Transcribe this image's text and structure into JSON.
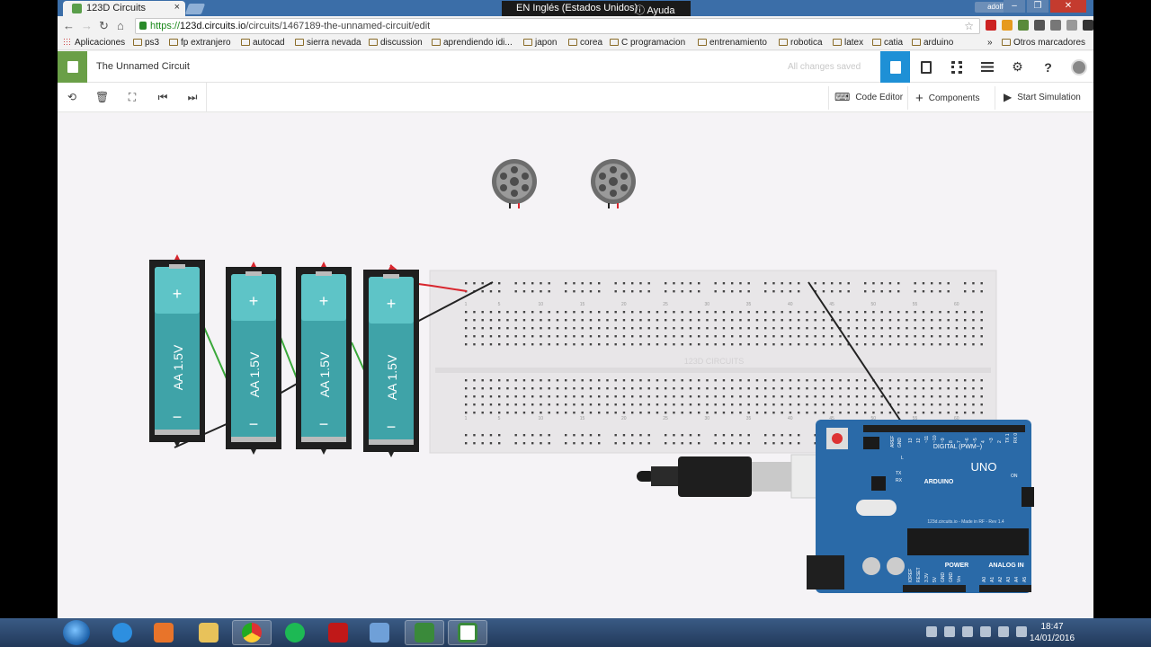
{
  "browser": {
    "tab_title": "123D Circuits",
    "tab_close": "×",
    "language_bar": "EN Inglés (Estados Unidos)",
    "help_label": "Ayuda",
    "user_badge": "adolfo",
    "url_scheme": "https://",
    "url_host": "123d.circuits.io",
    "url_path": "/circuits/1467189-the-unnamed-circuit/edit",
    "bookmarks": [
      "Aplicaciones",
      "ps3",
      "fp extranjero",
      "autocad",
      "sierra nevada",
      "discussion",
      "aprendiendo idi...",
      "japon",
      "corea",
      "C programacion",
      "entrenamiento",
      "robotica",
      "latex",
      "catia",
      "arduino"
    ],
    "bookmarks_overflow": "»",
    "other_bookmarks": "Otros marcadores"
  },
  "app": {
    "circuit_name": "The Unnamed Circuit",
    "save_status": "All changes saved",
    "header_icons": [
      "breadboard-view-icon",
      "schematic-view-icon",
      "pcb-view-icon",
      "component-list-icon",
      "settings-icon",
      "help-icon",
      "user-avatar-icon"
    ],
    "help_glyph": "?",
    "toolbar": {
      "code_editor": "Code Editor",
      "components": "Components",
      "start_simulation": "Start Simulation"
    }
  },
  "canvas": {
    "battery_label": "AA 1.5V",
    "battery_plus": "+",
    "battery_minus": "−",
    "breadboard_watermark": "123D CIRCUITS",
    "breadboard_columns": [
      "1",
      "5",
      "10",
      "15",
      "20",
      "25",
      "30",
      "35",
      "40",
      "45",
      "50",
      "55",
      "60"
    ],
    "breadboard_rows_top": [
      "J",
      "I",
      "H",
      "G",
      "F"
    ],
    "breadboard_rows_bottom": [
      "E",
      "D",
      "C",
      "B",
      "A"
    ],
    "arduino": {
      "brand": "ARDUINO",
      "model": "UNO",
      "digital_label": "DIGITAL (PWM~)",
      "power_label": "POWER",
      "analog_label": "ANALOG IN",
      "footer_text": "123d.circuits.io - Made in RF - Rev 1.4",
      "leds": [
        "L",
        "TX",
        "RX"
      ],
      "on_label": "ON",
      "aref_label": "AREF",
      "gnd_label": "GND",
      "digital_pins": [
        "13",
        "12",
        "~11",
        "~10",
        "~9",
        "8",
        "7",
        "~6",
        "~5",
        "4",
        "~3",
        "2",
        "TX 1",
        "RX 0"
      ],
      "power_pins": [
        "IOREF",
        "RESET",
        "3.3V",
        "5V",
        "GND",
        "GND",
        "Vin"
      ],
      "analog_pins": [
        "A0",
        "A1",
        "A2",
        "A3",
        "A4",
        "A5"
      ]
    },
    "colors": {
      "battery_teal": "#3fa3a8",
      "battery_top": "#5ec4c7",
      "wire_green": "#3aa83a",
      "wire_red": "#d8262e",
      "wire_black": "#222222",
      "arduino_blue": "#2a6aa8",
      "breadboard": "#e8e6e8"
    }
  },
  "taskbar": {
    "time": "18:47",
    "date": "14/01/2016"
  }
}
